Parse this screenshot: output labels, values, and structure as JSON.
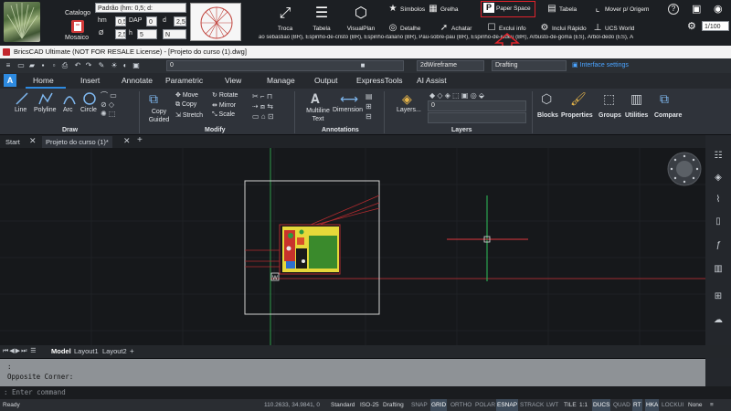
{
  "plugin_bar": {
    "catalog_label": "Catalogo",
    "mosaic_label": "Mosaico",
    "preset_value": "Padrão (hm: 0,5; d:",
    "fields": [
      {
        "label": "hm",
        "value": "0,5"
      },
      {
        "label": "DAP",
        "value": "0"
      },
      {
        "label": "d",
        "value": "2,5"
      },
      {
        "label": "h",
        "value": "5"
      },
      {
        "label": "Ø",
        "value": "2,5"
      },
      {
        "label": "",
        "value": "N"
      }
    ],
    "tools": [
      {
        "label": "Troca",
        "icon": "swap-arrows-icon"
      },
      {
        "label": "Tabela",
        "icon": "table-list-icon"
      },
      {
        "label": "VisualPlan",
        "icon": "visualplan-icon"
      }
    ],
    "mini_tools": [
      {
        "label": "Símbolos",
        "icon": "star-icon"
      },
      {
        "label": "Grelha",
        "icon": "grid-icon"
      },
      {
        "label": "Paper Space",
        "icon": "paper-space-icon"
      },
      {
        "label": "Tabela",
        "icon": "table-icon"
      },
      {
        "label": "Mover p/ Origem",
        "icon": "move-origin-icon"
      },
      {
        "label": "Detalhe",
        "icon": "detail-icon"
      },
      {
        "label": "Achatar",
        "icon": "flatten-icon"
      },
      {
        "label": "Exclui info",
        "icon": "exclude-info-icon"
      },
      {
        "label": "Inclui Rápido",
        "icon": "include-quick-icon"
      },
      {
        "label": "UCS World",
        "icon": "ucs-world-icon"
      }
    ],
    "species_marquee": "ão sebastião (BR), Espinho-de-cristo (BR), Espinho-italiano (BR), Pau-sobre-pau (BR), Espinho-de-judeu (BR), Arbusto-de-goma (ES), Árbol-dedo (ES), Á",
    "scale_value": "1/100"
  },
  "title_bar": {
    "title": "BricsCAD Ultimate (NOT FOR RESALE License) - [Projeto do curso (1).dwg]"
  },
  "quick_access": {
    "layer_value": "0",
    "visual_style": "2dWireframe",
    "workspace": "Drafting",
    "interface_settings": "Interface settings"
  },
  "ribbon_tabs": [
    "Home",
    "Insert",
    "Annotate",
    "Parametric",
    "View",
    "Manage",
    "Output",
    "ExpressTools",
    "AI Assist"
  ],
  "ribbon": {
    "draw": {
      "title": "Draw",
      "items": [
        "Line",
        "Polyline",
        "Arc",
        "Circle"
      ]
    },
    "modify": {
      "title": "Modify",
      "copy_guided": "Copy Guided",
      "items": [
        "Move",
        "Rotate",
        "Copy",
        "Mirror",
        "Stretch",
        "Scale"
      ]
    },
    "annotations": {
      "title": "Annotations",
      "multiline": "Multiline Text",
      "dimension": "Dimension"
    },
    "layers": {
      "title": "Layers",
      "layers_button": "Layers...",
      "layer_value": "0"
    },
    "panels": [
      "Blocks",
      "Properties",
      "Groups",
      "Utilities",
      "Compare"
    ]
  },
  "doc_tabs": {
    "start": "Start",
    "active": "Projeto do curso (1)*"
  },
  "layout_tabs": [
    "Model",
    "Layout1",
    "Layout2"
  ],
  "command": {
    "history": [
      ":",
      "Opposite Corner:"
    ],
    "prompt": ": Enter command"
  },
  "status_bar": {
    "ready": "Ready",
    "coords": "110.2633, 34.9841, 0",
    "items": [
      "Standard",
      "ISO-25",
      "Drafting",
      "SNAP",
      "GRID",
      "ORTHO",
      "POLAR",
      "ESNAP",
      "STRACK",
      "LWT",
      "TILE",
      "1:1",
      "DUCS",
      "QUAD",
      "RT",
      "HKA",
      "LOCKUI",
      "None"
    ],
    "active_items": [
      "GRID",
      "ESNAP",
      "DUCS",
      "RT",
      "HKA"
    ]
  },
  "colors": {
    "accent": "#2d8ae0",
    "highlight": "#e0232b",
    "canvas": "#16181b",
    "ucs_x": "#e0373f",
    "ucs_y": "#2fbf5a"
  }
}
